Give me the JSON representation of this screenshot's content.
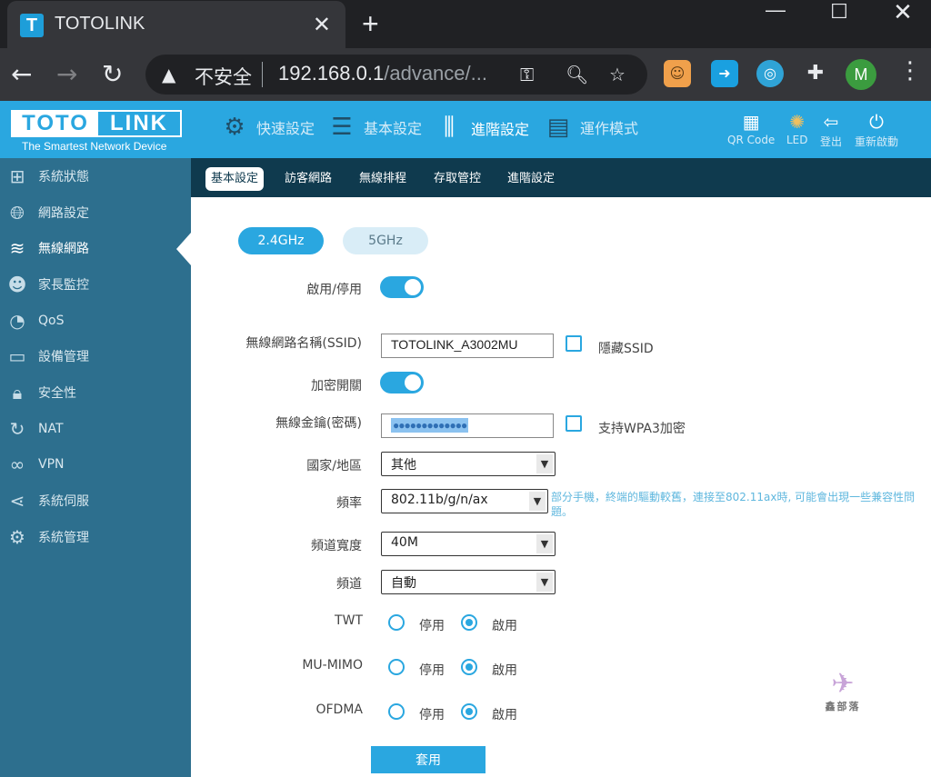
{
  "browser": {
    "tab_title": "TOTOLINK",
    "favicon_letter": "T",
    "new_tab": "+",
    "insecure_label": "不安全",
    "url_host": "192.168.0.1",
    "url_path": "/advance/...",
    "avatar_letter": "M"
  },
  "header": {
    "logo_left": "TOTO",
    "logo_right": "LINK",
    "tagline": "The Smartest Network Device",
    "nav": [
      {
        "label": "快速設定",
        "icon": "gear-icon"
      },
      {
        "label": "基本設定",
        "icon": "list-icon"
      },
      {
        "label": "進階設定",
        "icon": "sliders-icon"
      },
      {
        "label": "運作模式",
        "icon": "mode-icon"
      }
    ],
    "tools": [
      {
        "label": "QR Code",
        "icon": "qr-code-icon"
      },
      {
        "label": "LED",
        "icon": "led-icon"
      },
      {
        "label": "登出",
        "icon": "logout-icon"
      },
      {
        "label": "重新啟動",
        "icon": "power-icon"
      }
    ]
  },
  "sidebar": {
    "items": [
      {
        "label": "系統狀態",
        "icon": "network-status-icon"
      },
      {
        "label": "網路設定",
        "icon": "globe-icon"
      },
      {
        "label": "無線網路",
        "icon": "wifi-icon"
      },
      {
        "label": "家長監控",
        "icon": "parental-icon"
      },
      {
        "label": "QoS",
        "icon": "gauge-icon"
      },
      {
        "label": "設備管理",
        "icon": "devices-icon"
      },
      {
        "label": "安全性",
        "icon": "lock-icon"
      },
      {
        "label": "NAT",
        "icon": "refresh-icon"
      },
      {
        "label": "VPN",
        "icon": "link-icon"
      },
      {
        "label": "系統伺服",
        "icon": "share-icon"
      },
      {
        "label": "系統管理",
        "icon": "settings-icon"
      }
    ],
    "active_index": 2
  },
  "subtabs": [
    "基本設定",
    "訪客網路",
    "無線排程",
    "存取管控",
    "進階設定"
  ],
  "form": {
    "band_24": "2.4GHz",
    "band_5": "5GHz",
    "enable_label": "啟用/停用",
    "ssid_label": "無線網路名稱(SSID)",
    "ssid_value": "TOTOLINK_A3002MU",
    "hide_ssid_label": "隱藏SSID",
    "encrypt_label": "加密開關",
    "key_label": "無線金鑰(密碼)",
    "key_mask": "●●●●●●●●●●●●●",
    "wpa3_label": "支持WPA3加密",
    "country_label": "國家/地區",
    "country_value": "其他",
    "mode_label": "頻率",
    "mode_value": "802.11b/g/n/ax",
    "mode_hint": "部分手機，終端的驅動較舊，連接至802.11ax時, 可能會出現一些兼容性問題。",
    "bandwidth_label": "頻道寬度",
    "bandwidth_value": "40M",
    "channel_label": "頻道",
    "channel_value": "自動",
    "twt_label": "TWT",
    "mumimo_label": "MU-MIMO",
    "ofdma_label": "OFDMA",
    "disable_text": "停用",
    "enable_text": "啟用",
    "apply_label": "套用"
  },
  "watermark_text": "鑫部落"
}
